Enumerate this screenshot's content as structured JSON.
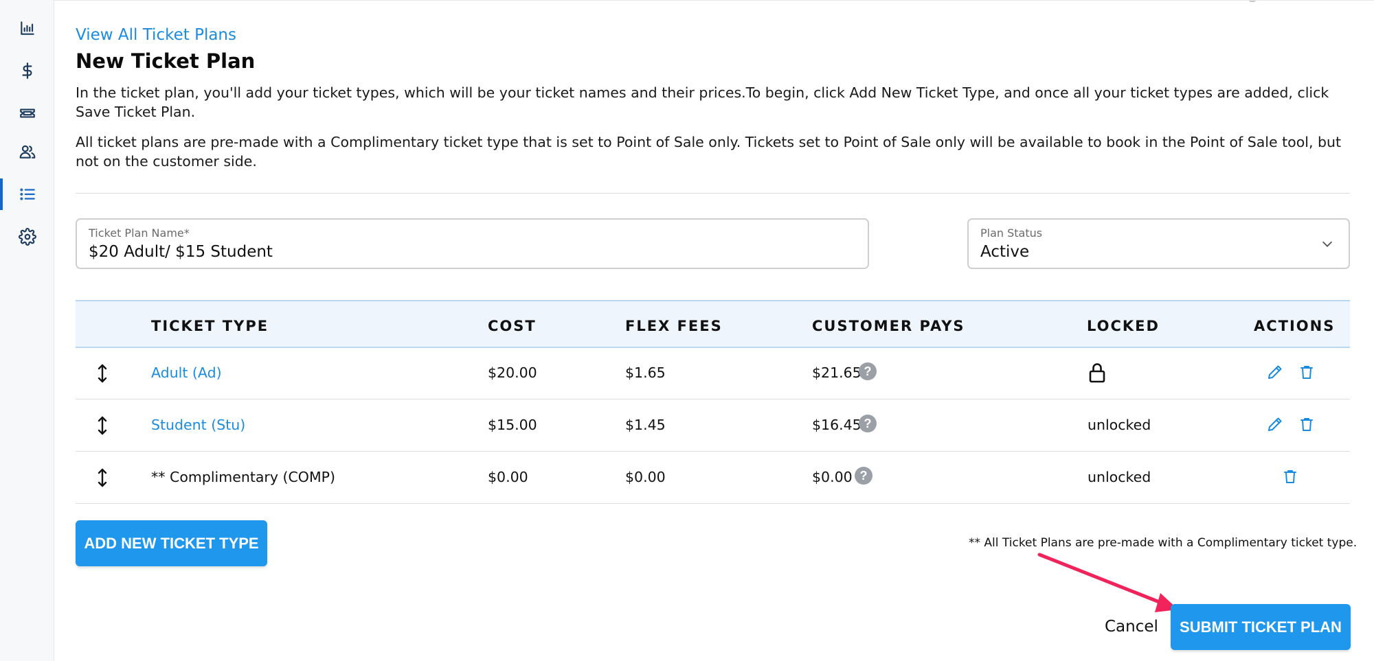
{
  "sidebar": {
    "items": [
      {
        "icon": "bar-chart-icon"
      },
      {
        "icon": "dollar-icon"
      },
      {
        "icon": "ticket-icon"
      },
      {
        "icon": "users-icon"
      },
      {
        "icon": "list-icon",
        "active": true
      },
      {
        "icon": "gear-icon"
      }
    ]
  },
  "header": {
    "back_link": "View All Ticket Plans",
    "title": "New Ticket Plan",
    "paragraph1": "In the ticket plan, you'll add your ticket types, which will be your ticket names and their prices.To begin, click Add New Ticket Type, and once all your ticket types are added, click Save Ticket Plan.",
    "paragraph2": "All ticket plans are pre-made with a Complimentary ticket type that is set to Point of Sale only. Tickets set to Point of Sale only will be available to book in the Point of Sale tool, but not on the customer side."
  },
  "form": {
    "plan_name_label": "Ticket Plan Name*",
    "plan_name_value": "$20 Adult/ $15 Student",
    "status_label": "Plan Status",
    "status_value": "Active"
  },
  "table": {
    "headers": {
      "ticket_type": "TICKET TYPE",
      "cost": "COST",
      "flex_fees": "FLEX FEES",
      "customer_pays": "CUSTOMER PAYS",
      "locked": "LOCKED",
      "actions": "ACTIONS"
    },
    "rows": [
      {
        "ticket_type": "Adult (Ad)",
        "cost": "$20.00",
        "flex_fees": "$1.65",
        "customer_pays": "$21.65",
        "locked": "",
        "is_locked": true,
        "editable": true
      },
      {
        "ticket_type": "Student (Stu)",
        "cost": "$15.00",
        "flex_fees": "$1.45",
        "customer_pays": "$16.45",
        "locked": "unlocked",
        "is_locked": false,
        "editable": true
      },
      {
        "ticket_type": "** Complimentary (COMP)",
        "cost": "$0.00",
        "flex_fees": "$0.00",
        "customer_pays": "$0.00",
        "locked": "unlocked",
        "is_locked": false,
        "editable": false
      }
    ]
  },
  "footer": {
    "add_button": "ADD NEW TICKET TYPE",
    "note": "** All Ticket Plans are pre-made with a Complimentary ticket type.",
    "cancel": "Cancel",
    "submit_button": "SUBMIT TICKET PLAN"
  },
  "colors": {
    "accent": "#1e97ec",
    "link": "#1a8ce0",
    "header_bg": "#eef5fd",
    "annotation_arrow": "#f0245a"
  }
}
